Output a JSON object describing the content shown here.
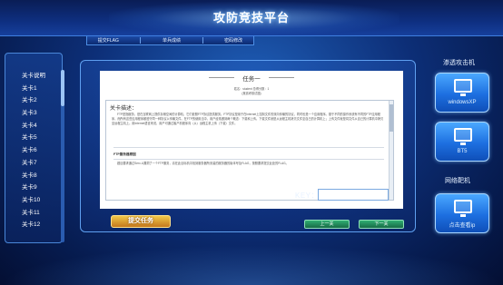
{
  "header": {
    "title": "攻防竞技平台",
    "nav": [
      "提交FLAG",
      "单兵成绩",
      "密码修改"
    ]
  },
  "levels": [
    "关卡说明",
    "关卡1",
    "关卡2",
    "关卡3",
    "关卡4",
    "关卡5",
    "关卡6",
    "关卡7",
    "关卡8",
    "关卡9",
    "关卡10",
    "关卡11",
    "关卡12"
  ],
  "task": {
    "title": "任务一",
    "meta_line1": "姓名：student  总得分数：1",
    "meta_line2": "(竞赛考核试题)",
    "desc_label": "关卡描述：",
    "paragraph1": "FTP是指服务，是在互联网上提供存储空间的计算机，它们依照FTP协议提供服务。FTP协议是用于在Internet上控制文件的双向传输的协议，同时也是一个应用程序。基于不同的操作系统有不同的FTP应用程序，而所有这些应用程序都遵守同一种协议以传输文件。在FTP的使用当中，用户经常遇到两个概念：下载和上传。下载文件就是从远程主机拷贝文件至自己的计算机上；上传文件就是将文件从自己的计算机中拷贝至远程主机上。用Internet语言来说，用户可通过客户机程序向（从）远程主机上传（下载）文件。",
    "heading": "FTP服务器原因",
    "paragraph2": "题目要求通过Serv-U漏洞了一个FTP服务，请在此目标机中找到服务器所安装的服务器的版本号及FLAG，按照要求提交此处的FLAG。"
  },
  "key": {
    "label": "KEY：",
    "value": "",
    "placeholder": ""
  },
  "buttons": {
    "submit": "提交任务",
    "prev": "上一关",
    "next": "下一关"
  },
  "right_panel": {
    "attack_heading": "渗透攻击机",
    "target_heading": "网络靶机",
    "machines": [
      {
        "label": "windowsXP"
      },
      {
        "label": "BT5"
      },
      {
        "label": "点击查看ip"
      }
    ]
  }
}
